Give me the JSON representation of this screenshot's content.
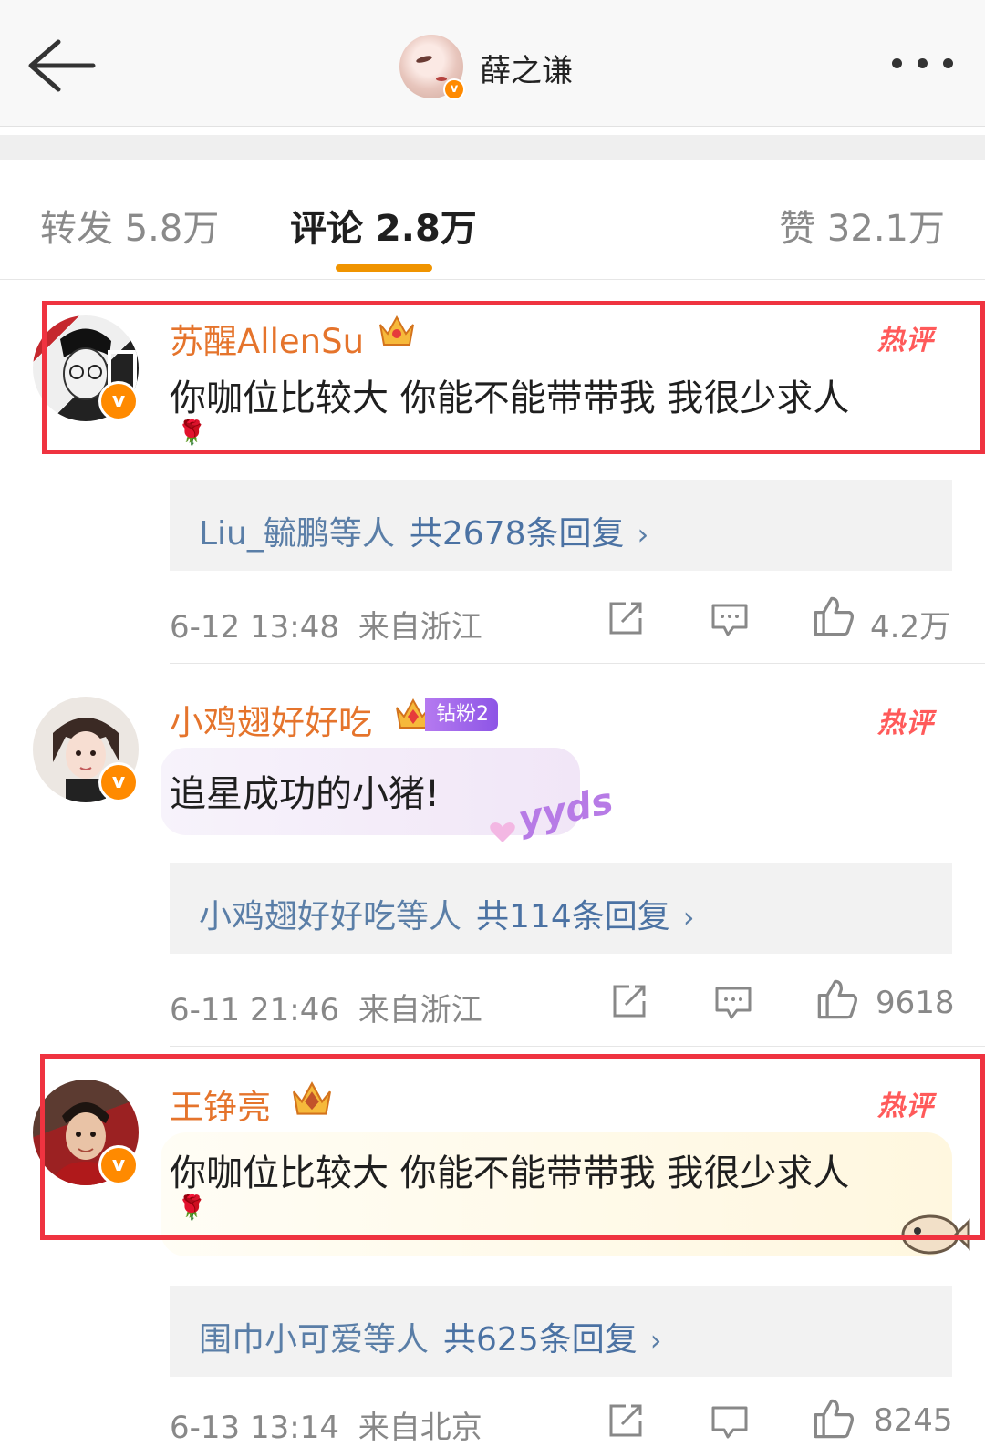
{
  "header": {
    "title": "薛之谦"
  },
  "tabs": {
    "repost": "转发 5.8万",
    "comment": "评论 2.8万",
    "like": "赞 32.1万"
  },
  "hot_label": "热评",
  "comments": [
    {
      "username": "苏醒AllenSu",
      "text": "你咖位比较大 你能不能带带我 我很少求人",
      "emoji": "🌹",
      "reply_names": "Liu_毓鹏等人",
      "reply_count": "共2678条回复",
      "date": "6-12 13:48",
      "location": "来自浙江",
      "likes": "4.2万"
    },
    {
      "username": "小鸡翅好好吃",
      "badge": "钻粉2",
      "text": "追星成功的小猪!",
      "sticker": "yyds",
      "reply_names": "小鸡翅好好吃等人",
      "reply_count": "共114条回复",
      "date": "6-11 21:46",
      "location": "来自浙江",
      "likes": "9618"
    },
    {
      "username": "王铮亮",
      "text": "你咖位比较大 你能不能带带我 我很少求人",
      "emoji": "🌹",
      "reply_names": "围巾小可爱等人",
      "reply_count": "共625条回复",
      "date": "6-13 13:14",
      "location": "来自北京",
      "likes": "8245"
    }
  ],
  "colors": {
    "accent": "#f09400",
    "username": "#e5742c",
    "highlight_box": "#ef3340",
    "link": "#4b72a3"
  }
}
